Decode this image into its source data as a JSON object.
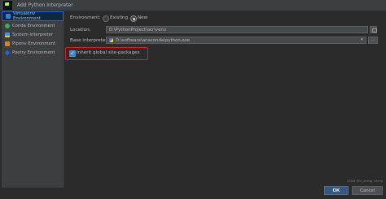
{
  "window": {
    "title": "Add Python Interpreter"
  },
  "sidebar": {
    "items": [
      {
        "label": "Virtualenv Environment",
        "icon": "virtualenv-icon",
        "selected": true
      },
      {
        "label": "Conda Environment",
        "icon": "conda-icon",
        "selected": false
      },
      {
        "label": "System Interpreter",
        "icon": "system-interpreter-icon",
        "selected": false
      },
      {
        "label": "Pipenv Environment",
        "icon": "pipenv-icon",
        "selected": false
      },
      {
        "label": "Poetry Environment",
        "icon": "poetry-icon",
        "selected": false
      }
    ]
  },
  "form": {
    "environment_label": "Environment:",
    "existing_label": "Existing",
    "new_label": "New",
    "selected_option": "New",
    "location_label": "Location:",
    "location_value": "D:\\PythonProject\\ocr\\venv",
    "base_interpreter_label": "Base interpreter:",
    "base_interpreter_value": "D:\\software\\anaconda\\python.exe",
    "browse_label": "...",
    "inherit_label": "Inherit global site-packages",
    "inherit_checked": true
  },
  "footer": {
    "ok_label": "OK",
    "cancel_label": "Cancel",
    "watermark": "CSDN @fu_sheng_sheng"
  },
  "colors": {
    "background": "#2b2b2b",
    "selection_border": "#2f65ca",
    "highlight_border": "#e0201f",
    "ok_button": "#365880"
  }
}
